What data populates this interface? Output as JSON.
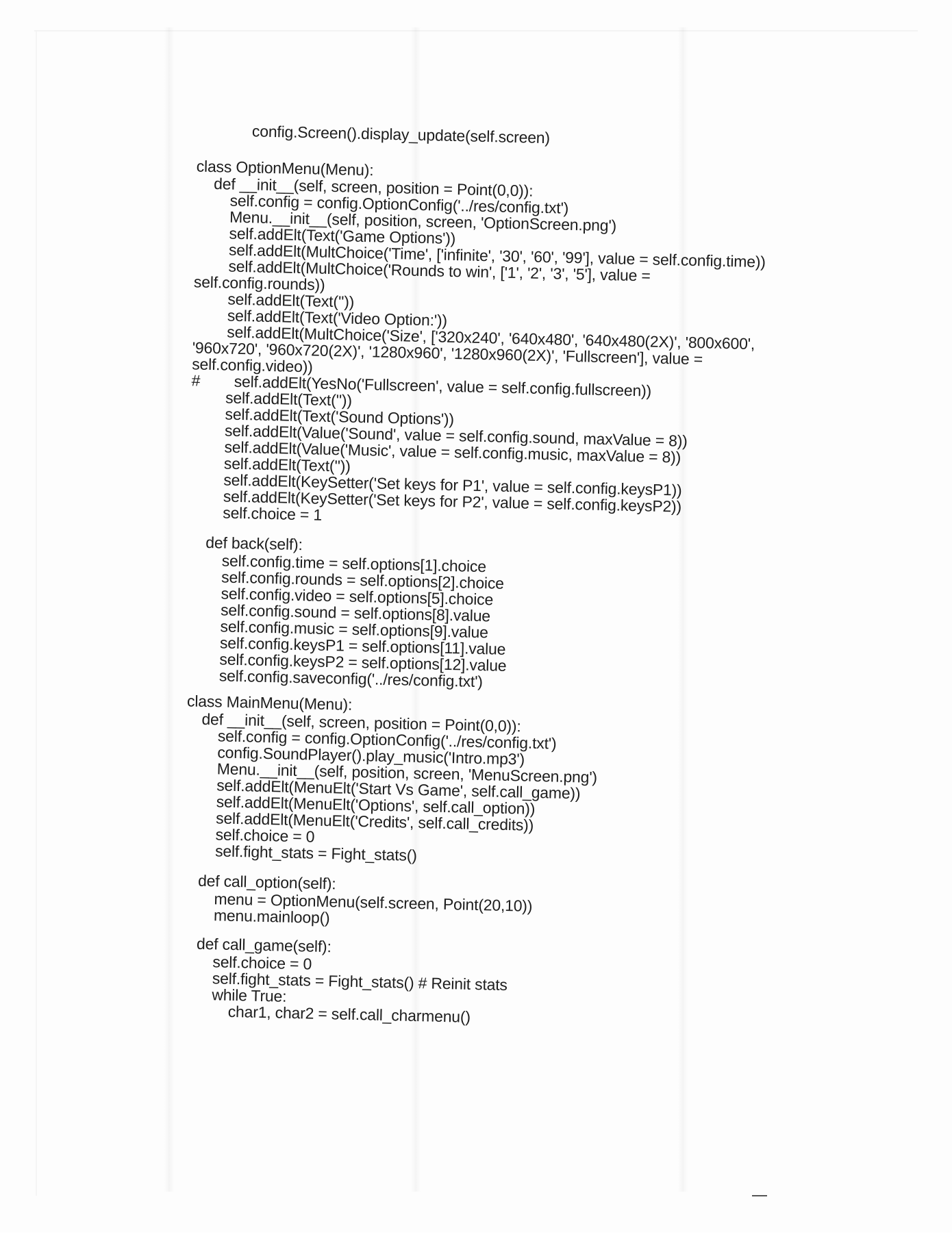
{
  "document": {
    "lines": [
      "config.Screen().display_update(self.screen)",
      "class OptionMenu(Menu):",
      "def __init__(self, screen, position = Point(0,0)):",
      "self.config = config.OptionConfig('../res/config.txt')",
      "Menu.__init__(self, position, screen, 'OptionScreen.png')",
      "self.addElt(Text('Game Options'))",
      "self.addElt(MultChoice('Time', ['infinite', '30', '60', '99'], value = self.config.time))",
      "self.addElt(MultChoice('Rounds to win', ['1', '2', '3', '5'], value =",
      "self.config.rounds))",
      "self.addElt(Text(''))",
      "self.addElt(Text('Video Option:'))",
      "self.addElt(MultChoice('Size', ['320x240', '640x480', '640x480(2X)', '800x600',",
      "'960x720', '960x720(2X)', '1280x960', '1280x960(2X)', 'Fullscreen'], value =",
      "self.config.video))",
      "#        self.addElt(YesNo('Fullscreen', value = self.config.fullscreen))",
      "self.addElt(Text(''))",
      "self.addElt(Text('Sound Options'))",
      "self.addElt(Value('Sound', value = self.config.sound, maxValue = 8))",
      "self.addElt(Value('Music', value = self.config.music, maxValue = 8))",
      "self.addElt(Text(''))",
      "self.addElt(KeySetter('Set keys for P1', value = self.config.keysP1))",
      "self.addElt(KeySetter('Set keys for P2', value = self.config.keysP2))",
      "self.choice = 1",
      "def back(self):",
      "self.config.time = self.options[1].choice",
      "self.config.rounds = self.options[2].choice",
      "self.config.video = self.options[5].choice",
      "self.config.sound = self.options[8].value",
      "self.config.music = self.options[9].value",
      "self.config.keysP1 = self.options[11].value",
      "self.config.keysP2 = self.options[12].value",
      "self.config.saveconfig('../res/config.txt')",
      "class MainMenu(Menu):",
      "def __init__(self, screen, position = Point(0,0)):",
      "self.config = config.OptionConfig('../res/config.txt')",
      "config.SoundPlayer().play_music('Intro.mp3')",
      "Menu.__init__(self, position, screen, 'MenuScreen.png')",
      "self.addElt(MenuElt('Start Vs Game', self.call_game))",
      "self.addElt(MenuElt('Options', self.call_option))",
      "self.addElt(MenuElt('Credits', self.call_credits))",
      "self.choice = 0",
      "self.fight_stats = Fight_stats()",
      "def call_option(self):",
      "menu = OptionMenu(self.screen, Point(20,10))",
      "menu.mainloop()",
      "def call_game(self):",
      "self.choice = 0",
      "self.fight_stats = Fight_stats() # Reinit stats",
      "while True:",
      "char1, char2 = self.call_charmenu()"
    ]
  }
}
